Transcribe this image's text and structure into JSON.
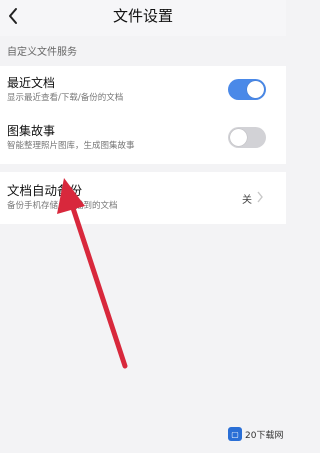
{
  "header": {
    "title": "文件设置",
    "back_icon": "chevron-left-icon"
  },
  "section_label": "自定义文件服务",
  "settings": {
    "recent_docs": {
      "title": "最近文档",
      "subtitle": "显示最近查看/下载/备份的文档",
      "enabled": true
    },
    "gallery_story": {
      "title": "图集故事",
      "subtitle": "智能整理照片图库，生成图集故事",
      "enabled": false
    },
    "auto_backup": {
      "title": "文档自动备份",
      "subtitle": "备份手机存储上扫描到的文档",
      "value": "关"
    }
  },
  "colors": {
    "toggle_on": "#4a89e8",
    "toggle_off": "#d2d2d6",
    "arrow": "#d8283c"
  },
  "watermark": {
    "text": "20下载网"
  }
}
